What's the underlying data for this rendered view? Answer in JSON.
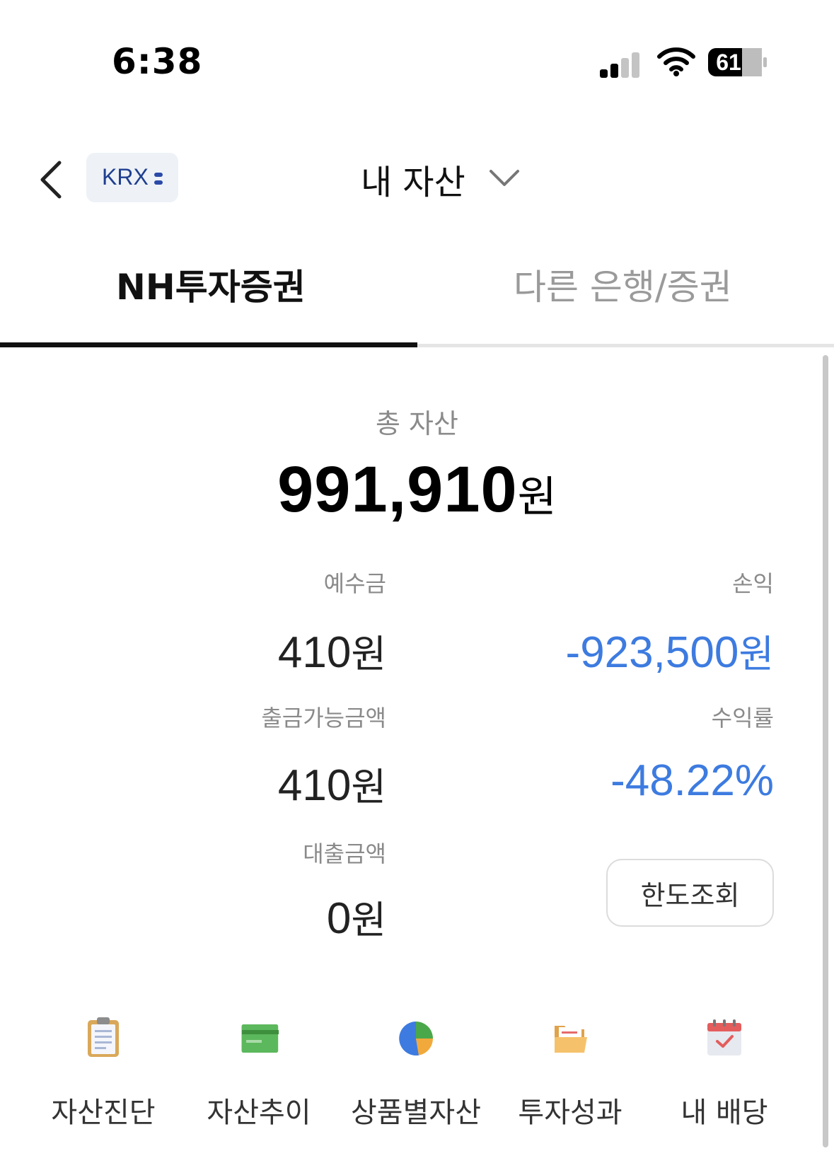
{
  "status_bar": {
    "time": "6:38",
    "battery": "61"
  },
  "header": {
    "back_icon": "chevron-left-icon",
    "exchange_badge": "KRX",
    "title": "내 자산",
    "title_dropdown_icon": "chevron-down-icon"
  },
  "tabs": [
    {
      "label": "NH투자증권",
      "active": true
    },
    {
      "label": "다른 은행/증권",
      "active": false
    }
  ],
  "summary": {
    "total_label": "총 자산",
    "total_value": "991,910",
    "total_unit": "원"
  },
  "details": {
    "deposit": {
      "label": "예수금",
      "value": "410",
      "unit": "원"
    },
    "profit": {
      "label": "손익",
      "value": "-923,500",
      "unit": "원"
    },
    "withdrawable": {
      "label": "출금가능금액",
      "value": "410",
      "unit": "원"
    },
    "return_rate": {
      "label": "수익률",
      "value": "-48.22%"
    },
    "loan": {
      "label": "대출금액",
      "value": "0",
      "unit": "원"
    },
    "limit_button": "한도조회"
  },
  "colors": {
    "negative": "#3d7be0",
    "tab_active": "#111111",
    "tab_inactive": "#9a9a9a"
  },
  "menu": [
    {
      "label": "자산진단",
      "icon": "clipboard-icon"
    },
    {
      "label": "자산추이",
      "icon": "card-icon"
    },
    {
      "label": "상품별자산",
      "icon": "pie-chart-icon"
    },
    {
      "label": "투자성과",
      "icon": "folder-icon"
    },
    {
      "label": "내 배당",
      "icon": "calendar-icon"
    }
  ]
}
